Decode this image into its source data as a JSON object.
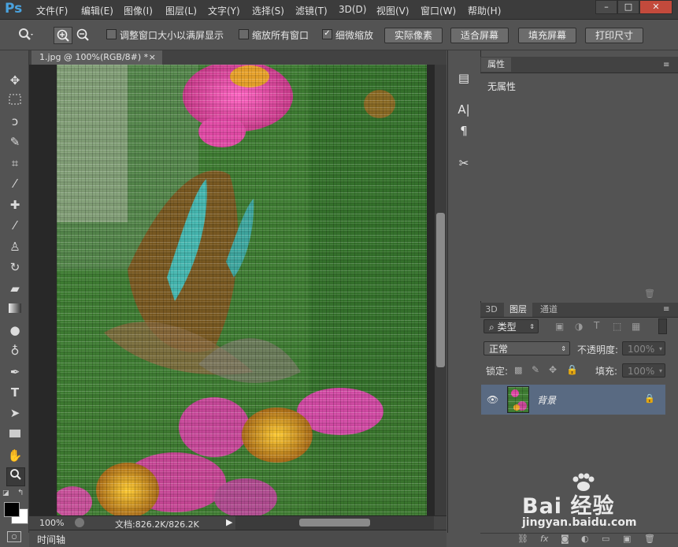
{
  "app": {
    "logo": "Ps"
  },
  "menu": [
    "文件(F)",
    "编辑(E)",
    "图像(I)",
    "图层(L)",
    "文字(Y)",
    "选择(S)",
    "滤镜(T)",
    "3D(D)",
    "视图(V)",
    "窗口(W)",
    "帮助(H)"
  ],
  "window_controls": {
    "minimize": "–",
    "restore": "□",
    "close": "✕"
  },
  "options": {
    "resize_windows": {
      "label": "调整窗口大小以满屏显示",
      "checked": false
    },
    "zoom_all_windows": {
      "label": "缩放所有窗口",
      "checked": false
    },
    "scrubby_zoom": {
      "label": "细微缩放",
      "checked": true
    },
    "buttons": [
      "实际像素",
      "适合屏幕",
      "填充屏幕",
      "打印尺寸"
    ]
  },
  "document": {
    "tab_title": "1.jpg @ 100%(RGB/8#) *",
    "tab_close": "×",
    "zoom": "100%",
    "doc_info": "文档:826.2K/826.2K"
  },
  "timeline": {
    "label": "时间轴"
  },
  "properties": {
    "tab": "属性",
    "content": "无属性"
  },
  "layers_panel": {
    "tabs": [
      "3D",
      "图层",
      "通道"
    ],
    "active_tab": "图层",
    "filter_kind": "类型",
    "blend_mode": "正常",
    "opacity_label": "不透明度:",
    "opacity_value": "100%",
    "lock_label": "锁定:",
    "fill_label": "填充:",
    "fill_value": "100%",
    "layers": [
      {
        "name": "背景",
        "visible": true,
        "locked": true
      }
    ]
  },
  "colors": {
    "accent": "#4aa3df",
    "selected_layer": "#596a82"
  },
  "watermark": {
    "brand": "Bai 经验",
    "url": "jingyan.baidu.com"
  }
}
